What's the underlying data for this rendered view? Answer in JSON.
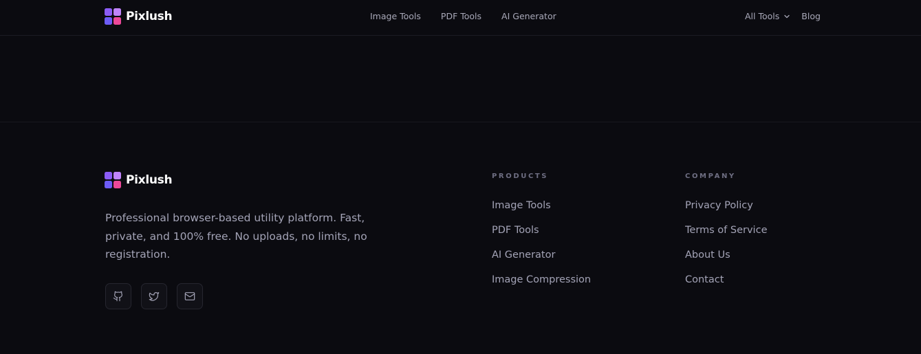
{
  "brand": {
    "name": "Pixlush",
    "logo_colors": [
      "#8b5cf6",
      "#c084fc",
      "#6d5cf6",
      "#ec4899"
    ]
  },
  "header": {
    "nav": [
      {
        "label": "Image Tools"
      },
      {
        "label": "PDF Tools"
      },
      {
        "label": "AI Generator"
      }
    ],
    "all_tools_label": "All Tools",
    "all_tools_icon": "chevron-down-icon",
    "blog_label": "Blog"
  },
  "footer": {
    "description": "Professional browser-based utility platform. Fast, private, and 100% free. No uploads, no limits, no registration.",
    "socials": [
      {
        "icon": "github-icon"
      },
      {
        "icon": "twitter-icon"
      },
      {
        "icon": "mail-icon"
      }
    ],
    "products": {
      "title": "PRODUCTS",
      "links": [
        "Image Tools",
        "PDF Tools",
        "AI Generator",
        "Image Compression"
      ]
    },
    "company": {
      "title": "COMPANY",
      "links": [
        "Privacy Policy",
        "Terms of Service",
        "About Us",
        "Contact"
      ]
    }
  },
  "colors": {
    "background": "#0b0b10",
    "text_muted": "#a3a3b6",
    "heading_muted": "#6e6e82"
  }
}
